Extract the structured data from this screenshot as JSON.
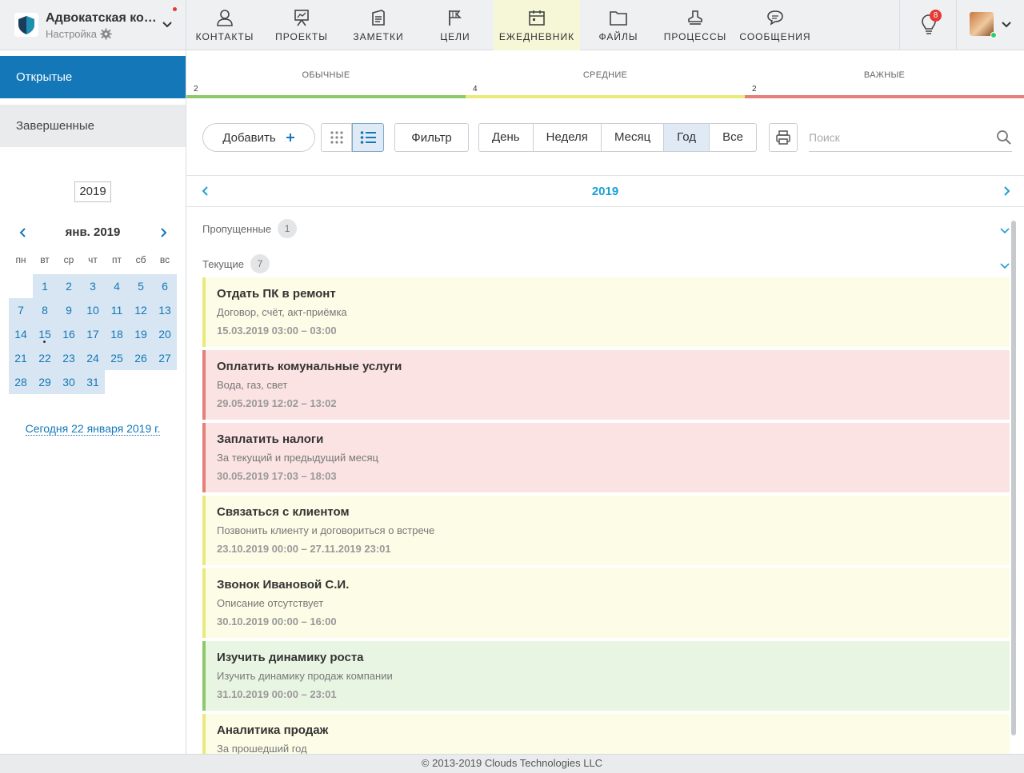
{
  "org": {
    "name": "Адвокатская контора",
    "subtitle": "Настройка"
  },
  "nav": [
    {
      "label": "КОНТАКТЫ",
      "icon": "user-icon"
    },
    {
      "label": "ПРОЕКТЫ",
      "icon": "presentation-icon"
    },
    {
      "label": "ЗАМЕТКИ",
      "icon": "notes-icon"
    },
    {
      "label": "ЦЕЛИ",
      "icon": "flag-icon"
    },
    {
      "label": "ЕЖЕДНЕВНИК",
      "icon": "calendar-icon",
      "active": true
    },
    {
      "label": "ФАЙЛЫ",
      "icon": "folder-icon"
    },
    {
      "label": "ПРОЦЕССЫ",
      "icon": "stamp-icon"
    },
    {
      "label": "СООБЩЕНИЯ",
      "icon": "chat-icon"
    }
  ],
  "notifications": {
    "count": "8"
  },
  "sidebar": {
    "tabs": {
      "open": "Открытые",
      "done": "Завершенные"
    },
    "year": "2019",
    "calendar": {
      "month_label": "янв. 2019",
      "weekdays": [
        "пн",
        "вт",
        "ср",
        "чт",
        "пт",
        "сб",
        "вс"
      ],
      "weeks": [
        [
          "",
          "1",
          "2",
          "3",
          "4",
          "5",
          "6"
        ],
        [
          "7",
          "8",
          "9",
          "10",
          "11",
          "12",
          "13"
        ],
        [
          "14",
          "15",
          "16",
          "17",
          "18",
          "19",
          "20"
        ],
        [
          "21",
          "22",
          "23",
          "24",
          "25",
          "26",
          "27"
        ],
        [
          "28",
          "29",
          "30",
          "31",
          "",
          "",
          ""
        ]
      ],
      "marked_day": "15"
    },
    "today": "Сегодня 22 января 2019 г."
  },
  "priorities": [
    {
      "label": "ОБЫЧНЫЕ",
      "count": "2",
      "color": "#8dc96a"
    },
    {
      "label": "СРЕДНИЕ",
      "count": "4",
      "color": "#eaea7a"
    },
    {
      "label": "ВАЖНЫЕ",
      "count": "2",
      "color": "#e57f7a"
    }
  ],
  "toolbar": {
    "add": "Добавить",
    "filter": "Фильтр",
    "periods": [
      "День",
      "Неделя",
      "Месяц",
      "Год",
      "Все"
    ],
    "active_period": "Год",
    "search_placeholder": "Поиск"
  },
  "year_nav": {
    "label": "2019"
  },
  "sections": {
    "missed": {
      "label": "Пропущенные",
      "count": "1"
    },
    "current": {
      "label": "Текущие",
      "count": "7"
    }
  },
  "tasks": [
    {
      "title": "Отдать ПК в ремонт",
      "desc": "Договор, счёт, акт-приёмка",
      "when": "15.03.2019 03:00 – 03:00",
      "priority": "medium"
    },
    {
      "title": "Оплатить комунальные услуги",
      "desc": "Вода, газ, свет",
      "when": "29.05.2019 12:02 – 13:02",
      "priority": "high"
    },
    {
      "title": "Заплатить налоги",
      "desc": "За текущий и предыдущий месяц",
      "when": "30.05.2019 17:03 – 18:03",
      "priority": "high"
    },
    {
      "title": "Связаться с клиентом",
      "desc": "Позвонить клиенту и договориться о встрече",
      "when": "23.10.2019 00:00 – 27.11.2019 23:01",
      "priority": "medium"
    },
    {
      "title": "Звонок Ивановой С.И.",
      "desc": "Описание отсутствует",
      "when": "30.10.2019 00:00 – 16:00",
      "priority": "medium"
    },
    {
      "title": "Изучить динамику роста",
      "desc": "Изучить динамику продаж компании",
      "when": "31.10.2019 00:00 – 23:01",
      "priority": "low"
    },
    {
      "title": "Аналитика продаж",
      "desc": "За прошедший год",
      "when": "",
      "priority": "medium"
    }
  ],
  "priority_colors": {
    "low": {
      "border": "#8dc96a",
      "bg": "#e9f5e3"
    },
    "medium": {
      "border": "#eaea7a",
      "bg": "#fcfce7"
    },
    "high": {
      "border": "#e57f7a",
      "bg": "#fbe3e3"
    }
  },
  "footer": "© 2013-2019 Clouds Technologies LLC"
}
